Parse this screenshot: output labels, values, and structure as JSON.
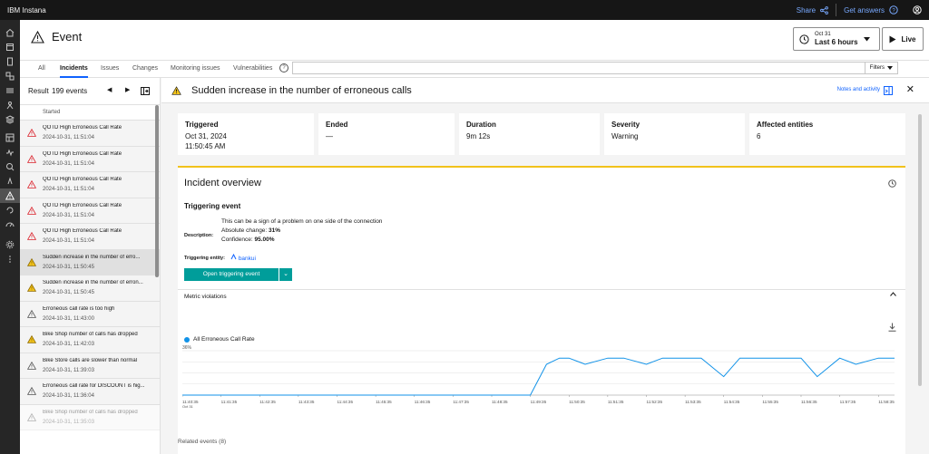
{
  "topbar": {
    "brand": "IBM Instana",
    "share": "Share",
    "get_answers": "Get answers"
  },
  "header": {
    "title": "Event",
    "time_date": "Oct 31",
    "time_range": "Last 6 hours",
    "live": "Live"
  },
  "tabs": [
    "All",
    "Incidents",
    "Issues",
    "Changes",
    "Monitoring issues",
    "Vulnerabilities"
  ],
  "filters_label": "Filters",
  "list": {
    "result_label": "Result",
    "result_count": "199 events",
    "column_header": "Started",
    "items": [
      {
        "name": "QOTD High Erroneous Call Rate",
        "time": "2024-10-31, 11:51:04"
      },
      {
        "name": "QOTD High Erroneous Call Rate",
        "time": "2024-10-31, 11:51:04"
      },
      {
        "name": "QOTD High Erroneous Call Rate",
        "time": "2024-10-31, 11:51:04"
      },
      {
        "name": "QOTD High Erroneous Call Rate",
        "time": "2024-10-31, 11:51:04"
      },
      {
        "name": "QOTD High Erroneous Call Rate",
        "time": "2024-10-31, 11:51:04"
      },
      {
        "name": "Sudden increase in the number of erro...",
        "time": "2024-10-31, 11:50:45"
      },
      {
        "name": "Sudden increase in the number of erron...",
        "time": "2024-10-31, 11:50:45"
      },
      {
        "name": "Erroneous call rate is too high",
        "time": "2024-10-31, 11:43:00"
      },
      {
        "name": "Bike Shop number of calls has dropped",
        "time": "2024-10-31, 11:42:03"
      },
      {
        "name": "Bike Store calls are slower than normal",
        "time": "2024-10-31, 11:39:03"
      },
      {
        "name": "Erroneous call rate for DISCOUNT is hig...",
        "time": "2024-10-31, 11:36:04"
      },
      {
        "name": "Bike Shop number of calls has dropped",
        "time": "2024-10-31, 11:35:03"
      }
    ]
  },
  "detail": {
    "title": "Sudden increase in the number of erroneous calls",
    "notes_label": "Notes and activity",
    "cards": [
      {
        "label": "Triggered",
        "line1": "Oct 31, 2024",
        "line2": "11:50:45 AM"
      },
      {
        "label": "Ended",
        "line1": "—",
        "line2": ""
      },
      {
        "label": "Duration",
        "line1": "9m 12s",
        "line2": ""
      },
      {
        "label": "Severity",
        "line1": "Warning",
        "line2": ""
      },
      {
        "label": "Affected entities",
        "line1": "6",
        "line2": ""
      }
    ],
    "overview": {
      "title": "Incident overview",
      "triggering_event": "Triggering event",
      "description_label": "Description:",
      "desc_line1": "This can be a sign of a problem on one side of the connection",
      "abs_label": "Absolute change: ",
      "abs_value": "31%",
      "conf_label": "Confidence: ",
      "conf_value": "95.00%",
      "triggering_entity_label": "Triggering entity:",
      "triggering_entity": "bankui",
      "open_button": "Open triggering event",
      "metric_violations": "Metric violations",
      "legend": "All Erroneous Call Rate"
    },
    "related_events": "Related events (8)"
  },
  "chart_data": {
    "type": "line",
    "series": [
      {
        "name": "All Erroneous Call Rate",
        "x": [
          "11:40:35",
          "11:41:35",
          "11:42:35",
          "11:43:35",
          "11:44:35",
          "11:45:35",
          "11:46:35",
          "11:47:35",
          "11:48:35",
          "11:49:35",
          "11:50:00",
          "11:50:20",
          "11:50:35",
          "11:51:00",
          "11:51:35",
          "11:52:00",
          "11:52:35",
          "11:53:00",
          "11:53:35",
          "11:54:00",
          "11:54:35",
          "11:55:00",
          "11:55:35",
          "11:56:00",
          "11:56:35",
          "11:57:00",
          "11:57:35",
          "11:58:00",
          "11:58:35",
          "11:59:00"
        ],
        "values": [
          0,
          0,
          0,
          0,
          0,
          0,
          0,
          0,
          0,
          0,
          25,
          30,
          30,
          25,
          30,
          30,
          25,
          30,
          30,
          30,
          15,
          30,
          30,
          30,
          30,
          15,
          30,
          25,
          30,
          30
        ]
      }
    ],
    "ylim": [
      0,
      36
    ],
    "y_tick_labels": [
      "36%"
    ],
    "x_tick_labels": [
      "11:40:35",
      "11:41:35",
      "11:42:35",
      "11:43:35",
      "11:44:35",
      "11:45:35",
      "11:46:35",
      "11:47:35",
      "11:48:35",
      "11:49:35",
      "11:50:35",
      "11:51:35",
      "11:52:35",
      "11:53:35",
      "11:54:35",
      "11:55:35",
      "11:56:35",
      "11:57:35",
      "11:58:35"
    ],
    "x_sub_label": "Oct 31",
    "grid": true,
    "color": "#1192e8"
  }
}
